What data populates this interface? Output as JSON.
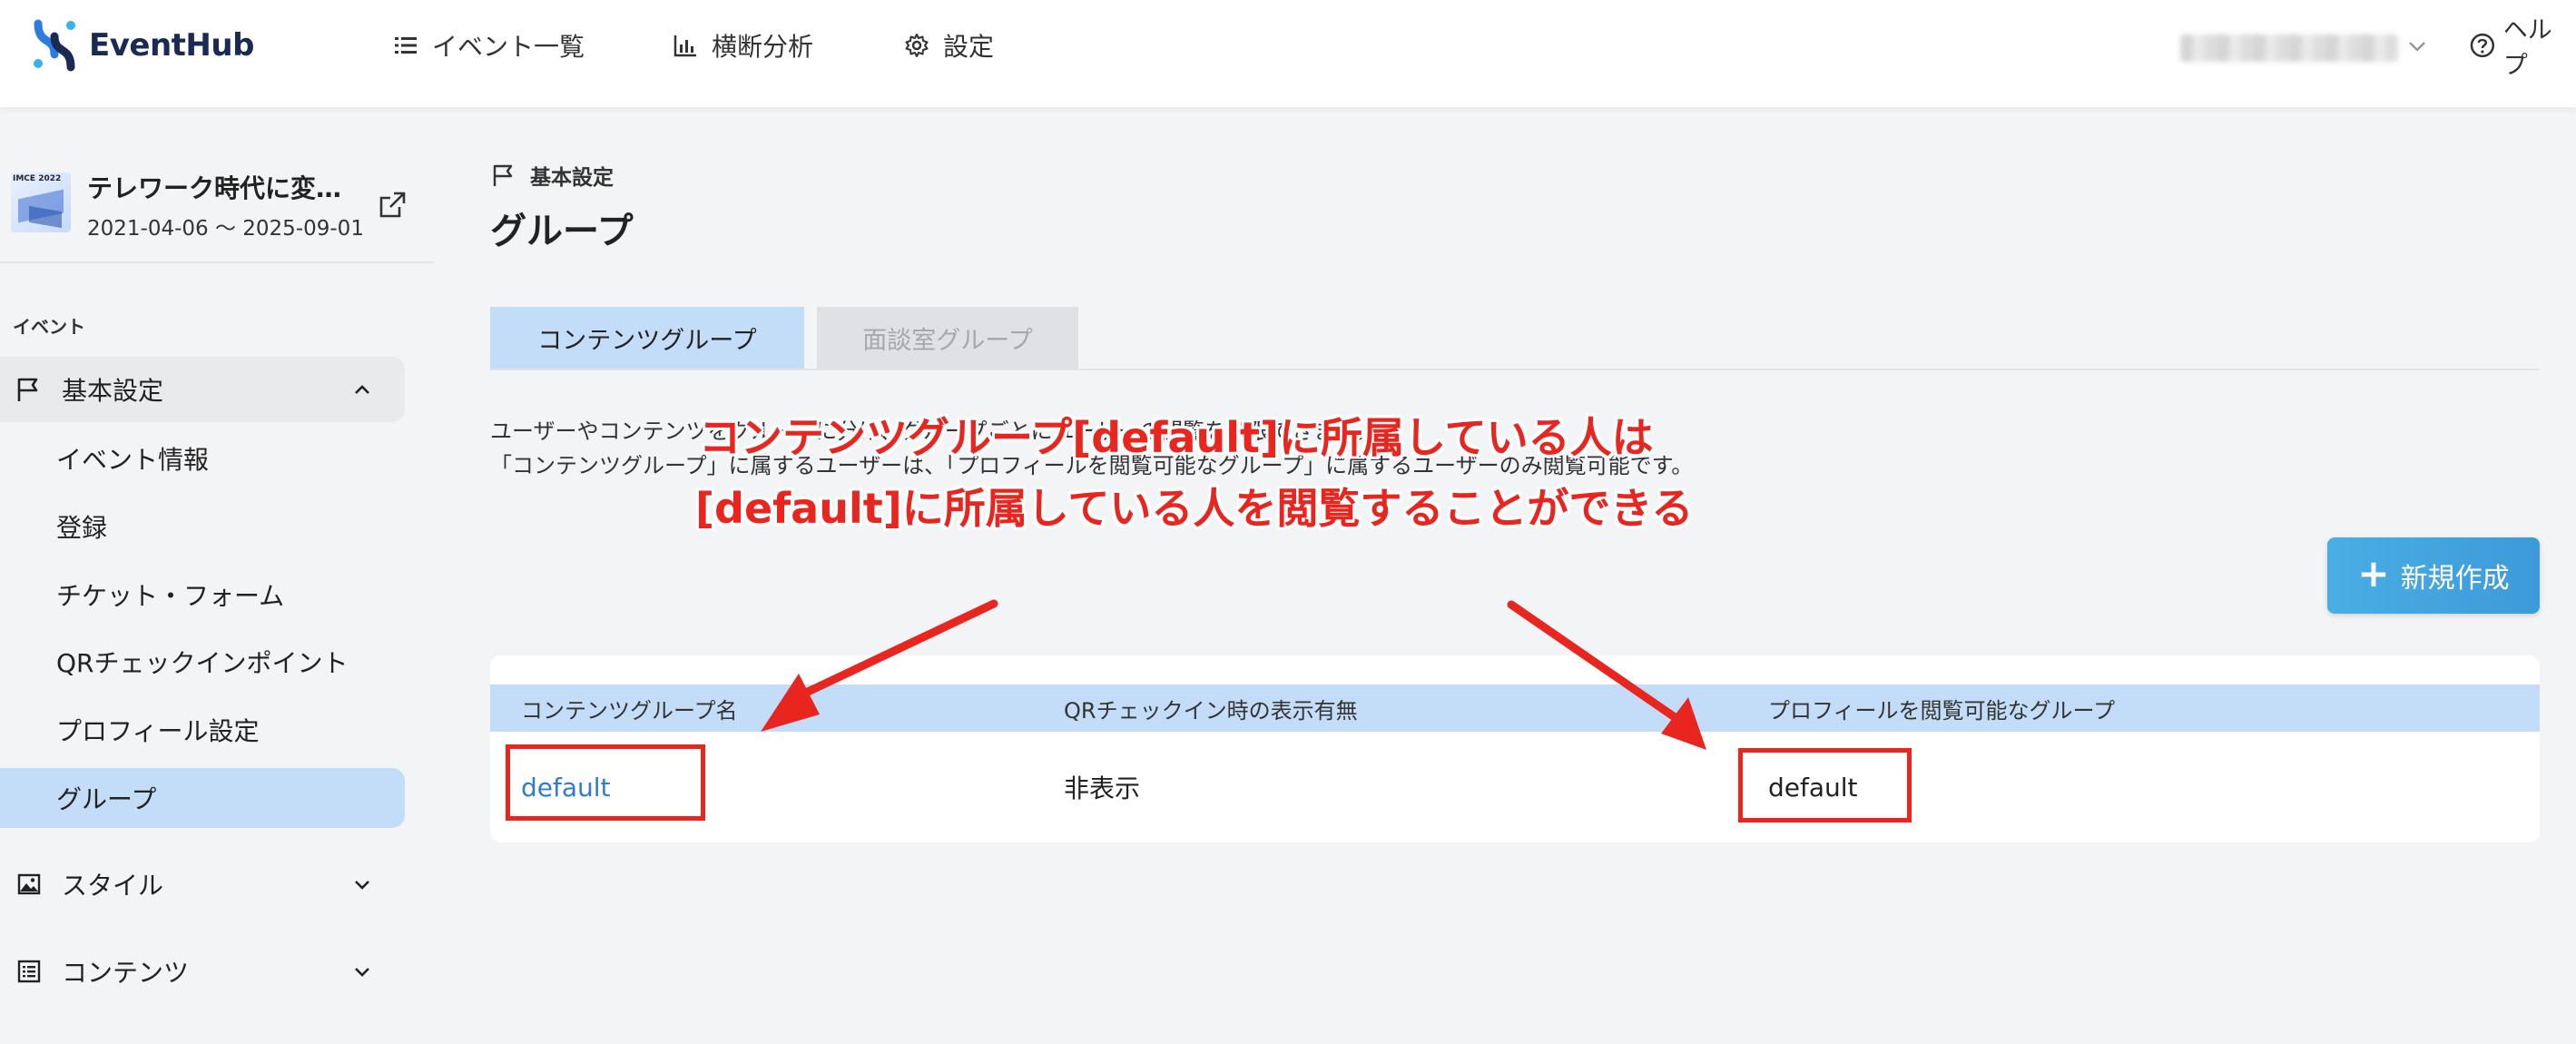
{
  "app": {
    "brand": "EventHub",
    "brand_color": "#1a2a55",
    "accent_color": "#3d9ad9"
  },
  "header": {
    "nav": [
      {
        "label": "イベント一覧",
        "icon": "list-icon"
      },
      {
        "label": "横断分析",
        "icon": "bar-chart-icon"
      },
      {
        "label": "設定",
        "icon": "gear-icon"
      }
    ],
    "user_menu": {
      "name_hidden": true,
      "icon": "chevron-down-icon"
    },
    "help": {
      "label": "ヘルプ",
      "icon": "question-circle-icon"
    }
  },
  "sidebar": {
    "event": {
      "title": "テレワーク時代に変…",
      "dates": "2021-04-06 〜 2025-09-01",
      "thumb_caption": "IMCE 2022"
    },
    "section_label": "イベント",
    "groups": [
      {
        "label": "基本設定",
        "icon": "flag-icon",
        "expanded": true
      },
      {
        "label": "スタイル",
        "icon": "image-icon",
        "expanded": false
      },
      {
        "label": "コンテンツ",
        "icon": "list-box-icon",
        "expanded": false
      }
    ],
    "items": [
      {
        "label": "イベント情報",
        "active": false
      },
      {
        "label": "登録",
        "active": false
      },
      {
        "label": "チケット・フォーム",
        "active": false
      },
      {
        "label": "QRチェックインポイント",
        "active": false
      },
      {
        "label": "プロフィール設定",
        "active": false
      },
      {
        "label": "グループ",
        "active": true
      }
    ]
  },
  "main": {
    "breadcrumb": "基本設定",
    "title": "グループ",
    "tabs": [
      {
        "label": "コンテンツグループ",
        "selected": true
      },
      {
        "label": "面談室グループ",
        "selected": false
      }
    ],
    "description": [
      "ユーザーやコンテンツをグループに分け、グループごとにユーザーの閲覧を制限できます。",
      "「コンテンツグループ」に属するユーザーは、「プロフィールを閲覧可能なグループ」に属するユーザーのみ閲覧可能です。"
    ],
    "new_button": "新規作成",
    "table": {
      "columns": [
        "コンテンツグループ名",
        "QRチェックイン時の表示有無",
        "プロフィールを閲覧可能なグループ"
      ],
      "rows": [
        [
          "default",
          "非表示",
          "default"
        ]
      ]
    }
  },
  "annotation": {
    "color": "#e8251e",
    "lines": [
      "コンテンツグループ[default]に所属している人は",
      "[default]に所属している人を閲覧することができる"
    ]
  }
}
